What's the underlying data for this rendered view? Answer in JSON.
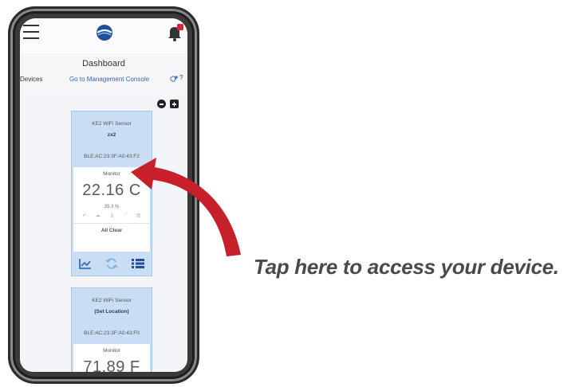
{
  "header": {
    "title": "Dashboard",
    "devices_link": "Devices",
    "console_link": "Go to Management Console",
    "help_label": "?"
  },
  "cards": [
    {
      "type": "KE2 WiFi Sensor",
      "name": "zx2",
      "mac": "BLE:AC:23:3F:A0:43:F2",
      "mode": "Monitor",
      "temperature": "22.16 C",
      "humidity": "35.3 %",
      "status": "All Clear"
    },
    {
      "type": "KE2 WiFi Sensor",
      "name": "(Set Location)",
      "mac": "BLE:AC:23:3F:A0:43:F0",
      "mode": "Monitor",
      "temperature": "71.89 F"
    }
  ],
  "caption": "Tap here to access your device.",
  "colors": {
    "card_bg": "#c9def4",
    "link_blue": "#3a66b0",
    "arrow_red": "#c8202a",
    "icon_blue": "#2f6ec0"
  },
  "icons": [
    "menu-icon",
    "logo-icon",
    "bell-icon",
    "gear-icon",
    "minus-icon",
    "plus-icon",
    "chart-icon",
    "refresh-icon",
    "list-icon"
  ]
}
